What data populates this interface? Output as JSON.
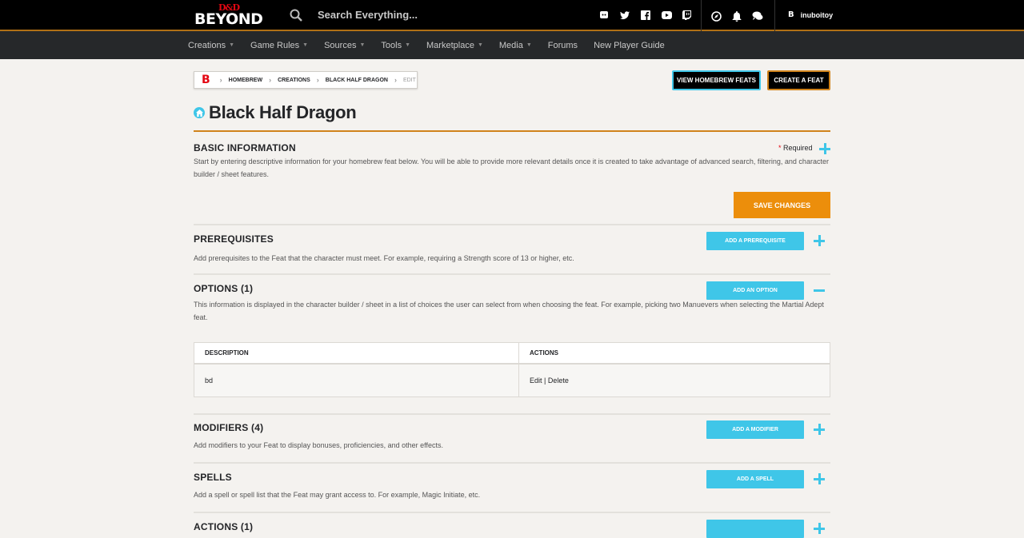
{
  "header": {
    "logo_top": "D&D",
    "logo_bottom": "BEYOND",
    "search_placeholder": "Search Everything...",
    "social_icons": [
      "discord-icon",
      "twitter-icon",
      "facebook-icon",
      "youtube-icon",
      "twitch-icon"
    ],
    "user_icons": [
      "compass-icon",
      "bell-icon",
      "chat-icon"
    ],
    "user_badge": "B",
    "username": "inuboitoy"
  },
  "nav": {
    "items": [
      {
        "label": "Creations",
        "caret": true
      },
      {
        "label": "Game Rules",
        "caret": true
      },
      {
        "label": "Sources",
        "caret": true
      },
      {
        "label": "Tools",
        "caret": true
      },
      {
        "label": "Marketplace",
        "caret": true
      },
      {
        "label": "Media",
        "caret": true
      },
      {
        "label": "Forums",
        "caret": false
      },
      {
        "label": "New Player Guide",
        "caret": false
      }
    ]
  },
  "breadcrumb": {
    "logo": "B",
    "items": [
      "HOMEBREW",
      "CREATIONS",
      "BLACK HALF DRAGON"
    ],
    "current": "EDIT"
  },
  "actions": {
    "view_homebrew": "VIEW HOMEBREW FEATS",
    "create_feat": "CREATE A FEAT"
  },
  "page": {
    "title": "Black Half Dragon",
    "accent_color": "#d0831b",
    "button_color": "#3fc6e8"
  },
  "basic": {
    "heading": "BASIC INFORMATION",
    "required_star": "*",
    "required_label": "Required",
    "description": "Start by entering descriptive information for your homebrew feat below. You will be able to provide more relevant details once it is created to take advantage of advanced search, filtering, and character builder / sheet features.",
    "save_label": "SAVE CHANGES"
  },
  "prerequisites": {
    "heading": "PREREQUISITES",
    "button": "ADD A PREREQUISITE",
    "description": "Add prerequisites to the Feat that the character must meet. For example, requiring a Strength score of 13 or higher, etc."
  },
  "options": {
    "heading": "OPTIONS (1)",
    "button": "ADD AN OPTION",
    "description": "This information is displayed in the character builder / sheet in a list of choices the user can select from when choosing the feat. For example, picking two Manuevers when selecting the Martial Adept feat.",
    "table": {
      "headers": [
        "DESCRIPTION",
        "ACTIONS"
      ],
      "rows": [
        {
          "description": "bd",
          "edit": "Edit",
          "divider": "|",
          "delete": "Delete"
        }
      ]
    }
  },
  "modifiers": {
    "heading": "MODIFIERS (4)",
    "button": "ADD A MODIFIER",
    "description": "Add modifiers to your Feat to display bonuses, proficiencies, and other effects."
  },
  "spells": {
    "heading": "SPELLS",
    "button": "ADD A SPELL",
    "description": "Add a spell or spell list that the Feat may grant access to. For example, Magic Initiate, etc."
  },
  "actions_section": {
    "heading": "ACTIONS (1)"
  }
}
